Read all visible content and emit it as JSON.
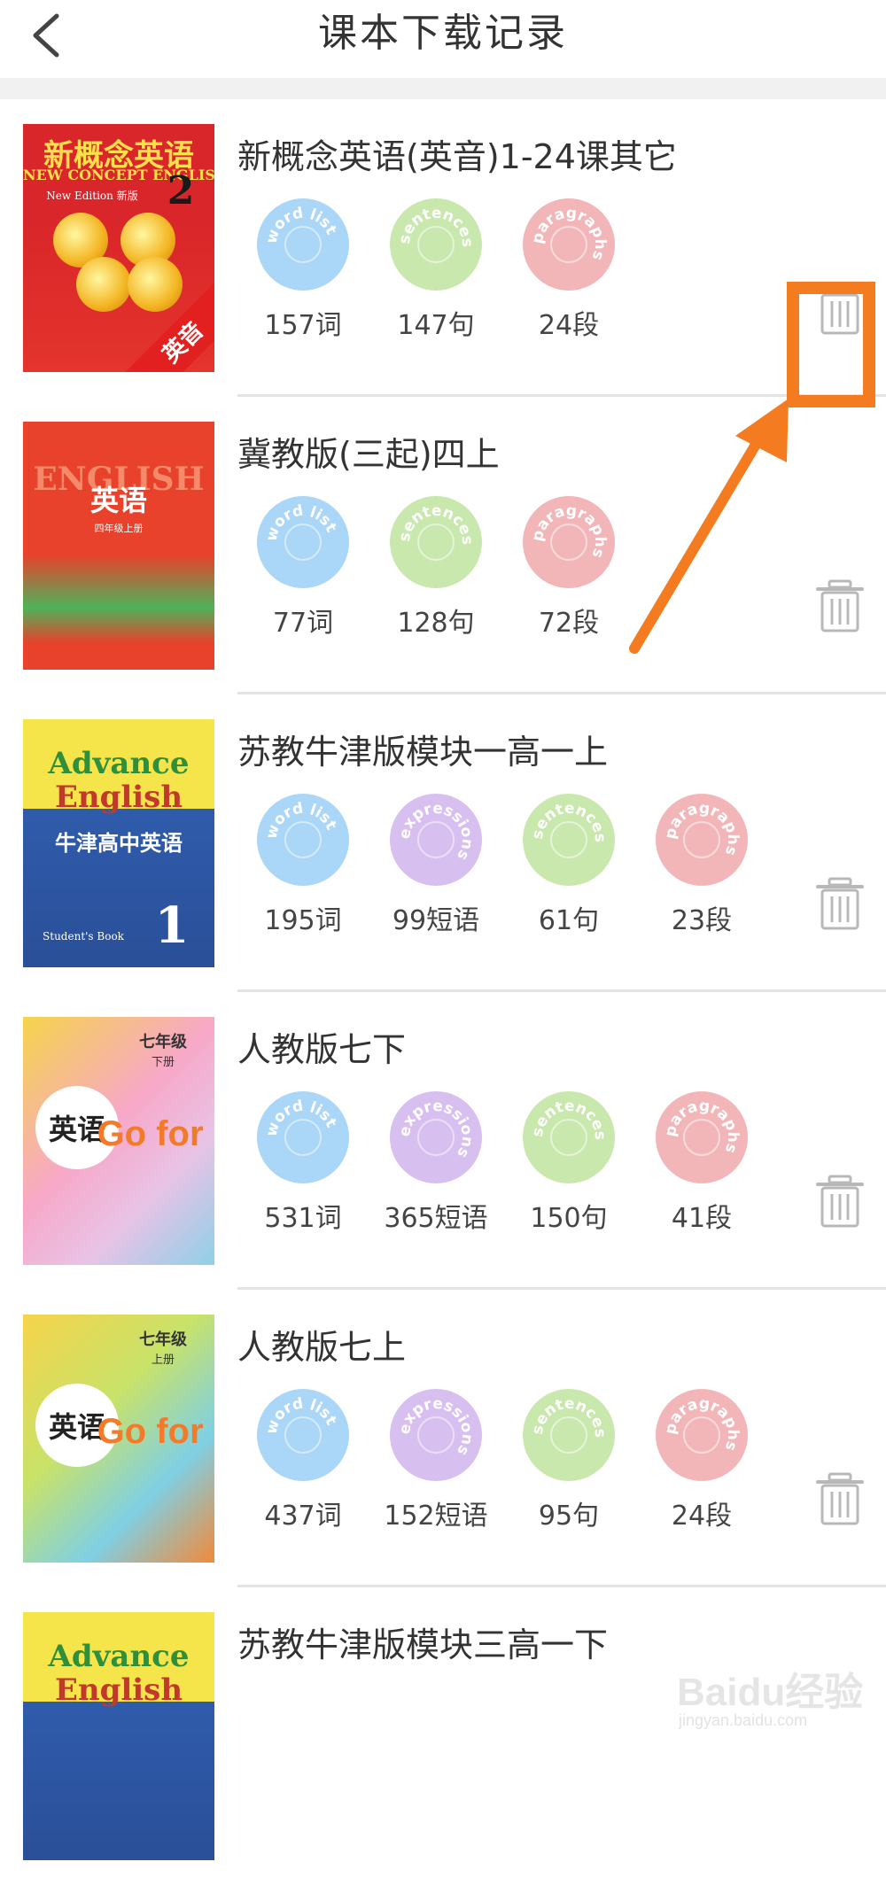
{
  "header": {
    "title": "课本下载记录",
    "back_icon": "chevron-left-icon"
  },
  "colors": {
    "word": "#aad6f7",
    "expression": "#d7bff0",
    "sentence": "#c9e8ad",
    "paragraph": "#f2b6b8",
    "accent": "#f47b20",
    "divider": "#e4e4e4"
  },
  "books": [
    {
      "title": "新概念英语(英音)1-24课其它",
      "cover": {
        "line1": "新概念英语",
        "line2": "NEW CONCEPT ENGLISH",
        "num": "2",
        "corner": "英音",
        "sub": "New Edition 新版"
      },
      "stats": [
        {
          "type": "word",
          "label": "157词"
        },
        {
          "type": "sentence",
          "label": "147句"
        },
        {
          "type": "paragraph",
          "label": "24段"
        }
      ]
    },
    {
      "title": "冀教版(三起)四上",
      "cover": {
        "line1": "ENGLISH",
        "line2": "英语",
        "sub": "四年级上册"
      },
      "stats": [
        {
          "type": "word",
          "label": "77词"
        },
        {
          "type": "sentence",
          "label": "128句"
        },
        {
          "type": "paragraph",
          "label": "72段"
        }
      ]
    },
    {
      "title": "苏教牛津版模块一高一上",
      "cover": {
        "line1": "Advance",
        "line2": "English",
        "line3": "牛津高中英语",
        "num": "1",
        "sub": "Student's Book"
      },
      "stats": [
        {
          "type": "word",
          "label": "195词"
        },
        {
          "type": "expression",
          "label": "99短语"
        },
        {
          "type": "sentence",
          "label": "61句"
        },
        {
          "type": "paragraph",
          "label": "23段"
        }
      ]
    },
    {
      "title": "人教版七下",
      "cover": {
        "line1": "英语",
        "line2": "Go for it!",
        "grade": "七年级",
        "vol": "下册"
      },
      "stats": [
        {
          "type": "word",
          "label": "531词"
        },
        {
          "type": "expression",
          "label": "365短语"
        },
        {
          "type": "sentence",
          "label": "150句"
        },
        {
          "type": "paragraph",
          "label": "41段"
        }
      ]
    },
    {
      "title": "人教版七上",
      "cover": {
        "line1": "英语",
        "line2": "Go for it!",
        "grade": "七年级",
        "vol": "上册"
      },
      "stats": [
        {
          "type": "word",
          "label": "437词"
        },
        {
          "type": "expression",
          "label": "152短语"
        },
        {
          "type": "sentence",
          "label": "95句"
        },
        {
          "type": "paragraph",
          "label": "24段"
        }
      ]
    },
    {
      "title": "苏教牛津版模块三高一下",
      "cover": {
        "line1": "Advance",
        "line2": "English"
      },
      "stats": []
    }
  ],
  "badge_words": {
    "word": "word list",
    "expression": "expressions",
    "sentence": "sentences",
    "paragraph": "paragraphs"
  },
  "watermark": {
    "text": "Baidu经验",
    "sub": "jingyan.baidu.com"
  }
}
